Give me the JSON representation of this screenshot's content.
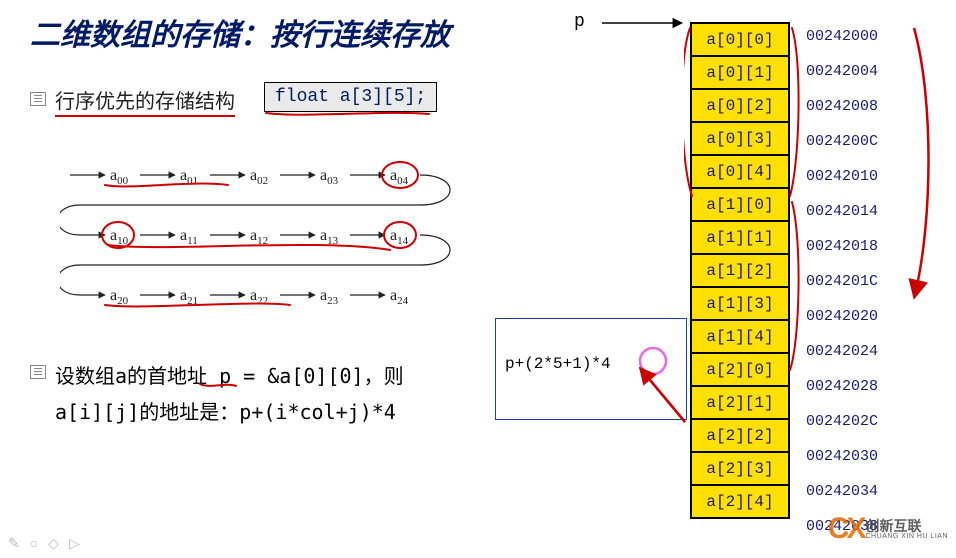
{
  "title": "二维数组的存储：按行连续存放",
  "sub1": "行序优先的存储结构",
  "code": "float a[3][5];",
  "flow": {
    "rows": [
      [
        "a₀₀",
        "a₀₁",
        "a₀₂",
        "a₀₃",
        "a₀₄"
      ],
      [
        "a₁₀",
        "a₁₁",
        "a₁₂",
        "a₁₃",
        "a₁₄"
      ],
      [
        "a₂₀",
        "a₂₁",
        "a₂₂",
        "a₂₃",
        "a₂₄"
      ]
    ]
  },
  "sub2_line1": "设数组a的首地址 p = &a[0][0]，则",
  "sub2_line2": "a[i][j]的地址是：p+(i*col+j)*4",
  "p_label": "p",
  "formula": "p+(2*5+1)*4",
  "mem": [
    {
      "cell": "a[0][0]",
      "addr": "00242000"
    },
    {
      "cell": "a[0][1]",
      "addr": "00242004"
    },
    {
      "cell": "a[0][2]",
      "addr": "00242008"
    },
    {
      "cell": "a[0][3]",
      "addr": "0024200C"
    },
    {
      "cell": "a[0][4]",
      "addr": "00242010"
    },
    {
      "cell": "a[1][0]",
      "addr": "00242014"
    },
    {
      "cell": "a[1][1]",
      "addr": "00242018"
    },
    {
      "cell": "a[1][2]",
      "addr": "0024201C"
    },
    {
      "cell": "a[1][3]",
      "addr": "00242020"
    },
    {
      "cell": "a[1][4]",
      "addr": "00242024"
    },
    {
      "cell": "a[2][0]",
      "addr": "00242028"
    },
    {
      "cell": "a[2][1]",
      "addr": "0024202C"
    },
    {
      "cell": "a[2][2]",
      "addr": "00242030"
    },
    {
      "cell": "a[2][3]",
      "addr": "00242034"
    },
    {
      "cell": "a[2][4]",
      "addr": "00242038"
    }
  ],
  "logo": {
    "brand": "创新互联",
    "sub": "CHUANG XIN HU LIAN"
  }
}
